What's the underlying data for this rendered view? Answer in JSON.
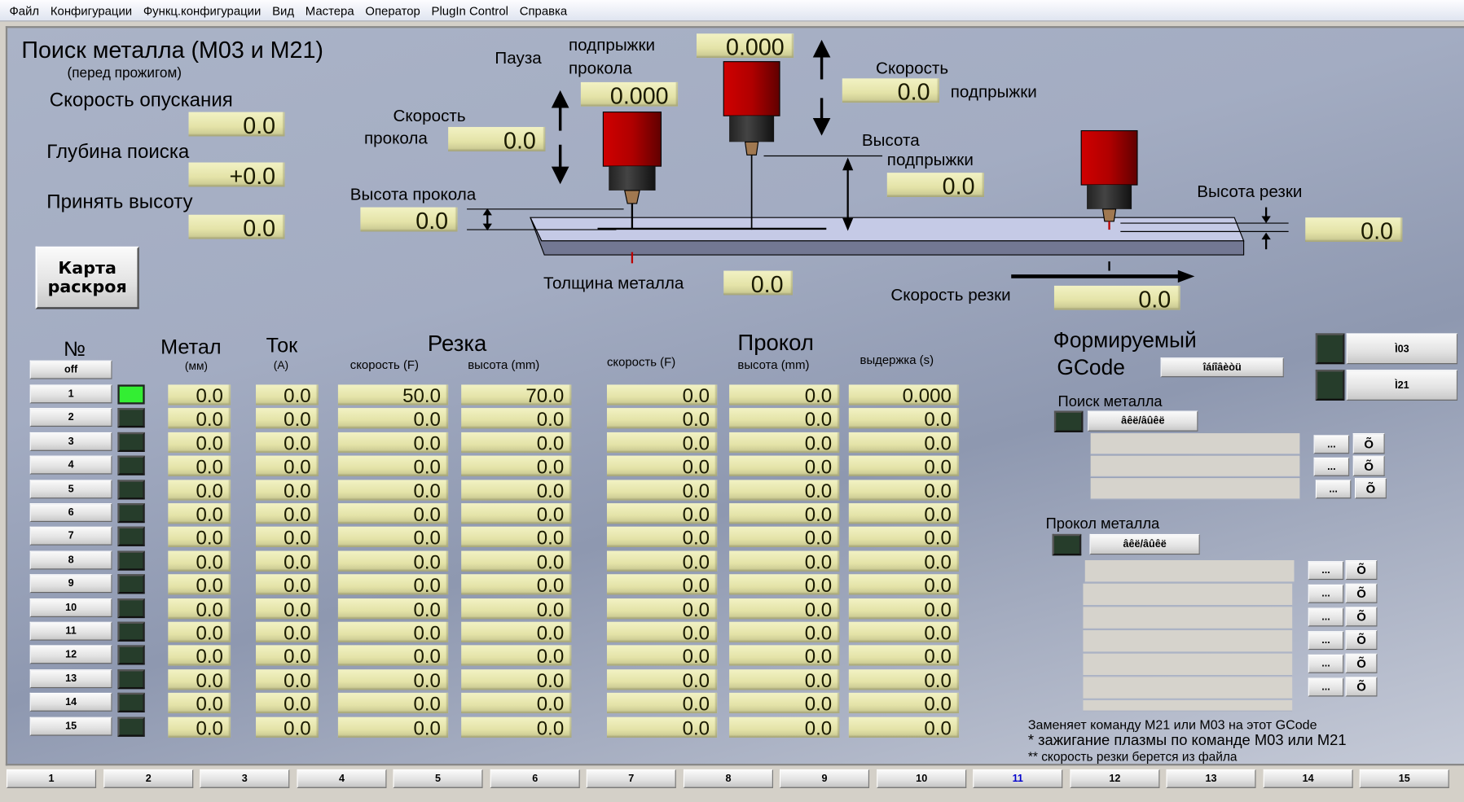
{
  "menu": [
    "Файл",
    "Конфигурации",
    "Функц.конфигурации",
    "Вид",
    "Мастера",
    "Оператор",
    "PlugIn Control",
    "Справка"
  ],
  "left": {
    "title": "Поиск металла (M03 и M21)",
    "subtitle": "(перед прожигом)",
    "descent_speed_label": "Скорость опускания",
    "descent_speed": "0.0",
    "search_depth_label": "Глубина поиска",
    "search_depth": "+0.0",
    "accept_height_label": "Принять высоту",
    "accept_height": "0.0",
    "cut_map_button": "Карта раскроя"
  },
  "diagram": {
    "pause_label": "Пауза",
    "pierce_jump_label_1": "подпрыжки",
    "pierce_jump_label_2": "прокола",
    "pierce_jump_pause": "0.000",
    "pause_value": "0.000",
    "pierce_speed_label_1": "Скорость",
    "pierce_speed_label_2": "прокола",
    "pierce_speed": "0.0",
    "jump_speed_label_1": "Скорость",
    "jump_speed_label_2": "подпрыжки",
    "jump_speed": "0.0",
    "jump_height_label_1": "Высота",
    "jump_height_label_2": "подпрыжки",
    "jump_height": "0.0",
    "pierce_height_label": "Высота прокола",
    "pierce_height": "0.0",
    "cut_height_label": "Высота резки",
    "cut_height": "0.0",
    "thickness_label": "Толщина металла",
    "thickness": "0.0",
    "cut_speed_label": "Скорость резки",
    "cut_speed": "0.0",
    "colors": {
      "torch": "#c00000",
      "plate": "#c5cae6"
    }
  },
  "table": {
    "headers": {
      "num": "№",
      "metal": "Метал",
      "metal_unit": "(мм)",
      "current": "Ток",
      "current_unit": "(A)",
      "cut": "Резка",
      "cut_speed": "скорость (F)",
      "cut_height": "высота (mm)",
      "pierce": "Прокол",
      "pierce_speed": "скорость (F)",
      "pierce_height": "высота (mm)",
      "pierce_delay": "выдержка (s)"
    },
    "off_button": "off",
    "rows": [
      {
        "n": "1",
        "active": true,
        "metal": "0.0",
        "current": "0.0",
        "cut_speed": "50.0",
        "cut_height": "70.0",
        "pierce_speed": "0.0",
        "pierce_height": "0.0",
        "delay": "0.000"
      },
      {
        "n": "2",
        "active": false,
        "metal": "0.0",
        "current": "0.0",
        "cut_speed": "0.0",
        "cut_height": "0.0",
        "pierce_speed": "0.0",
        "pierce_height": "0.0",
        "delay": "0.0"
      },
      {
        "n": "3",
        "active": false,
        "metal": "0.0",
        "current": "0.0",
        "cut_speed": "0.0",
        "cut_height": "0.0",
        "pierce_speed": "0.0",
        "pierce_height": "0.0",
        "delay": "0.0"
      },
      {
        "n": "4",
        "active": false,
        "metal": "0.0",
        "current": "0.0",
        "cut_speed": "0.0",
        "cut_height": "0.0",
        "pierce_speed": "0.0",
        "pierce_height": "0.0",
        "delay": "0.0"
      },
      {
        "n": "5",
        "active": false,
        "metal": "0.0",
        "current": "0.0",
        "cut_speed": "0.0",
        "cut_height": "0.0",
        "pierce_speed": "0.0",
        "pierce_height": "0.0",
        "delay": "0.0"
      },
      {
        "n": "6",
        "active": false,
        "metal": "0.0",
        "current": "0.0",
        "cut_speed": "0.0",
        "cut_height": "0.0",
        "pierce_speed": "0.0",
        "pierce_height": "0.0",
        "delay": "0.0"
      },
      {
        "n": "7",
        "active": false,
        "metal": "0.0",
        "current": "0.0",
        "cut_speed": "0.0",
        "cut_height": "0.0",
        "pierce_speed": "0.0",
        "pierce_height": "0.0",
        "delay": "0.0"
      },
      {
        "n": "8",
        "active": false,
        "metal": "0.0",
        "current": "0.0",
        "cut_speed": "0.0",
        "cut_height": "0.0",
        "pierce_speed": "0.0",
        "pierce_height": "0.0",
        "delay": "0.0"
      },
      {
        "n": "9",
        "active": false,
        "metal": "0.0",
        "current": "0.0",
        "cut_speed": "0.0",
        "cut_height": "0.0",
        "pierce_speed": "0.0",
        "pierce_height": "0.0",
        "delay": "0.0"
      },
      {
        "n": "10",
        "active": false,
        "metal": "0.0",
        "current": "0.0",
        "cut_speed": "0.0",
        "cut_height": "0.0",
        "pierce_speed": "0.0",
        "pierce_height": "0.0",
        "delay": "0.0"
      },
      {
        "n": "11",
        "active": false,
        "metal": "0.0",
        "current": "0.0",
        "cut_speed": "0.0",
        "cut_height": "0.0",
        "pierce_speed": "0.0",
        "pierce_height": "0.0",
        "delay": "0.0"
      },
      {
        "n": "12",
        "active": false,
        "metal": "0.0",
        "current": "0.0",
        "cut_speed": "0.0",
        "cut_height": "0.0",
        "pierce_speed": "0.0",
        "pierce_height": "0.0",
        "delay": "0.0"
      },
      {
        "n": "13",
        "active": false,
        "metal": "0.0",
        "current": "0.0",
        "cut_speed": "0.0",
        "cut_height": "0.0",
        "pierce_speed": "0.0",
        "pierce_height": "0.0",
        "delay": "0.0"
      },
      {
        "n": "14",
        "active": false,
        "metal": "0.0",
        "current": "0.0",
        "cut_speed": "0.0",
        "cut_height": "0.0",
        "pierce_speed": "0.0",
        "pierce_height": "0.0",
        "delay": "0.0"
      },
      {
        "n": "15",
        "active": false,
        "metal": "0.0",
        "current": "0.0",
        "cut_speed": "0.0",
        "cut_height": "0.0",
        "pierce_speed": "0.0",
        "pierce_height": "0.0",
        "delay": "0.0"
      }
    ]
  },
  "gcode": {
    "title_1": "Формируемый",
    "title_2": "GCode",
    "refresh_button": "îáíîâèòü",
    "m03_button": "Ì03",
    "m21_button": "Ì21",
    "search_label": "Поиск металла",
    "search_toggle": "âêë/âûêë",
    "pierce_label": "Прокол металла",
    "pierce_toggle": "âêë/âûêë",
    "browse_button": "...",
    "clear_button": "Õ",
    "note_1": "Заменяет команду M21 или M03 на этот GCode",
    "note_2": "* зажигание плазмы по команде M03 или M21",
    "note_3": "** скорость резки берется из файла"
  },
  "tabs": {
    "items": [
      "1",
      "2",
      "3",
      "4",
      "5",
      "6",
      "7",
      "8",
      "9",
      "10",
      "11",
      "12",
      "13",
      "14",
      "15"
    ],
    "active": "11",
    "active_color": "#0000cc"
  }
}
